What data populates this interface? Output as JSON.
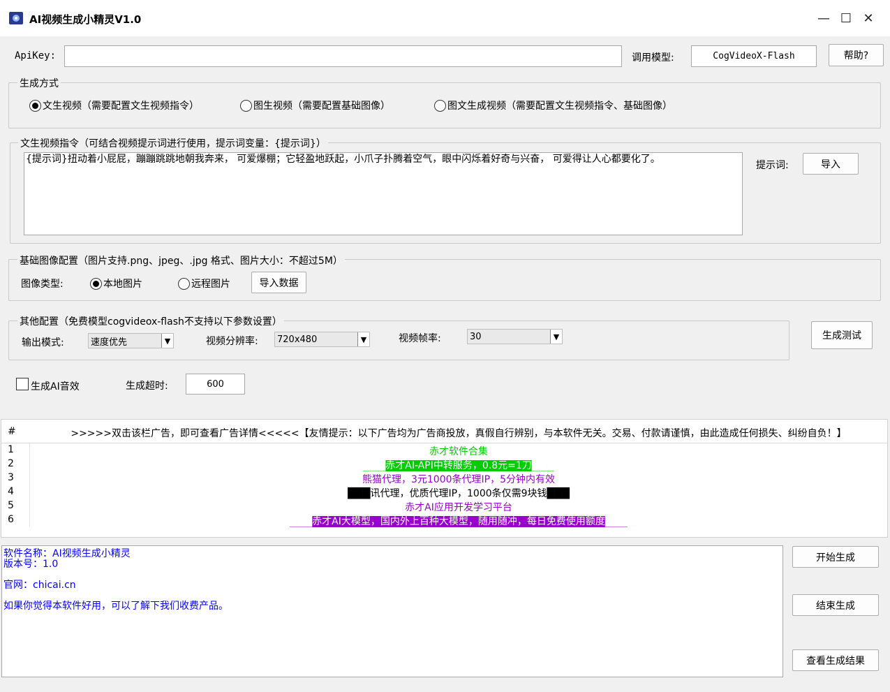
{
  "window": {
    "title": "AI视频生成小精灵V1.0",
    "minimize": "—",
    "maximize": "☐",
    "close": "✕"
  },
  "apikey": {
    "label": "ApiKey:",
    "value": ""
  },
  "model": {
    "label": "调用模型:",
    "value": "CogVideoX-Flash"
  },
  "help_button": "帮助?",
  "generation_mode": {
    "legend": "生成方式",
    "options": [
      {
        "label": "文生视频（需要配置文生视频指令）",
        "checked": true
      },
      {
        "label": "图生视频（需要配置基础图像）",
        "checked": false
      },
      {
        "label": "图文生成视频（需要配置文生视频指令、基础图像）",
        "checked": false
      }
    ]
  },
  "text_prompt": {
    "legend": "文生视频指令（可结合视频提示词进行使用，提示词变量：{提示词}）",
    "value": "{提示词}扭动着小屁屁，蹦蹦跳跳地朝我奔来， 可爱爆棚；它轻盈地跃起，小爪子扑腾着空气，眼中闪烁着好奇与兴奋， 可爱得让人心都要化了。",
    "hint_label": "提示词:",
    "import_button": "导入"
  },
  "base_image": {
    "legend": "基础图像配置（图片支持.png、jpeg、.jpg 格式、图片大小：不超过5M）",
    "type_label": "图像类型:",
    "options": [
      {
        "label": "本地图片",
        "checked": true
      },
      {
        "label": "远程图片",
        "checked": false
      }
    ],
    "import_button": "导入数据"
  },
  "other_config": {
    "legend": "其他配置（免费模型cogvideox-flash不支持以下参数设置）",
    "output_mode": {
      "label": "输出模式:",
      "value": "速度优先"
    },
    "resolution": {
      "label": "视频分辨率:",
      "value": "720x480"
    },
    "fps": {
      "label": "视频帧率:",
      "value": "30"
    },
    "test_button": "生成测试"
  },
  "ai_audio": {
    "label": "生成AI音效",
    "checked": false
  },
  "timeout": {
    "label": "生成超时:",
    "value": "600"
  },
  "ad_table": {
    "col_num": "#",
    "header": ">>>>>双击该栏广告，即可查看广告详情<<<<<【友情提示：以下广告均为广告商投放，真假自行辨别，与本软件无关。交易、付款请谨慎，由此造成任何损失、纠纷自负！】",
    "rows": [
      {
        "num": "1",
        "text": "赤才软件合集",
        "color": "#00cc00",
        "bg": ""
      },
      {
        "num": "2",
        "text": "███赤才AI-API中转服务，0.8元=1刀███",
        "color": "#ffffff",
        "bg": "#00cc00"
      },
      {
        "num": "3",
        "text": "熊猫代理，3元1000条代理IP，5分钟内有效",
        "color": "#9900cc",
        "bg": ""
      },
      {
        "num": "4",
        "text": "███讯代理，优质代理IP，1000条仅需9块钱███",
        "color": "#000000",
        "bg": ""
      },
      {
        "num": "5",
        "text": "赤才AI应用开发学习平台",
        "color": "#9900cc",
        "bg": ""
      },
      {
        "num": "6",
        "text": "███赤才AI大模型，国内外上百种大模型，随用随冲，每日免费使用额度███",
        "color": "#ffffff",
        "bg": "#9900cc"
      }
    ]
  },
  "log": {
    "lines": [
      "软件名称：AI视频生成小精灵",
      "版本号：1.0",
      "官网：chicai.cn",
      "如果你觉得本软件好用，可以了解下我们收费产品。"
    ]
  },
  "actions": {
    "start": "开始生成",
    "stop": "结束生成",
    "view": "查看生成结果"
  }
}
